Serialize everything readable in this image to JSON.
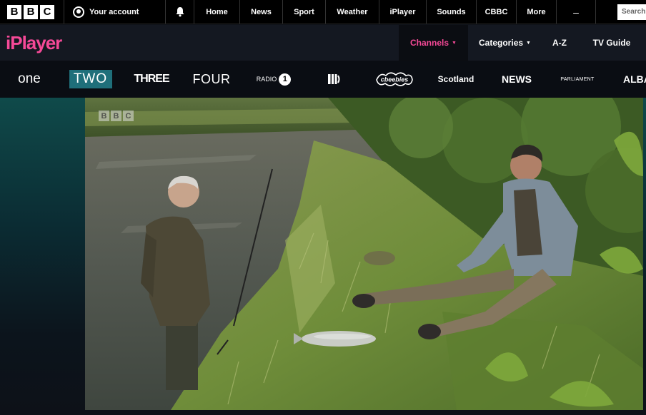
{
  "bbc_bar": {
    "logo": [
      "B",
      "B",
      "C"
    ],
    "account_label": "Your account",
    "notifications_icon": "bell-icon",
    "nav": [
      "Home",
      "News",
      "Sport",
      "Weather",
      "iPlayer",
      "Sounds",
      "CBBC",
      "More"
    ],
    "more_icon": "dash-icon",
    "search_placeholder": "Search"
  },
  "iplayer_bar": {
    "logo": "iPlayer",
    "menu": [
      {
        "label": "Channels",
        "active": true,
        "has_caret": true
      },
      {
        "label": "Categories",
        "active": false,
        "has_caret": true
      },
      {
        "label": "A-Z",
        "active": false,
        "has_caret": false
      },
      {
        "label": "TV Guide",
        "active": false,
        "has_caret": false
      }
    ],
    "accent_color": "#f54997"
  },
  "channels": {
    "items": [
      "one",
      "TWO",
      "THREE",
      "FOUR",
      "RADIO",
      "CBBC",
      "CBeebies",
      "Scotland",
      "NEWS",
      "PARLIAMENT",
      "ALBA"
    ],
    "radio_number": "1",
    "selected": "TWO",
    "selected_color": "#1f6f7a"
  },
  "player": {
    "watermark": [
      "B",
      "B",
      "C"
    ],
    "scene": "video-frame"
  }
}
